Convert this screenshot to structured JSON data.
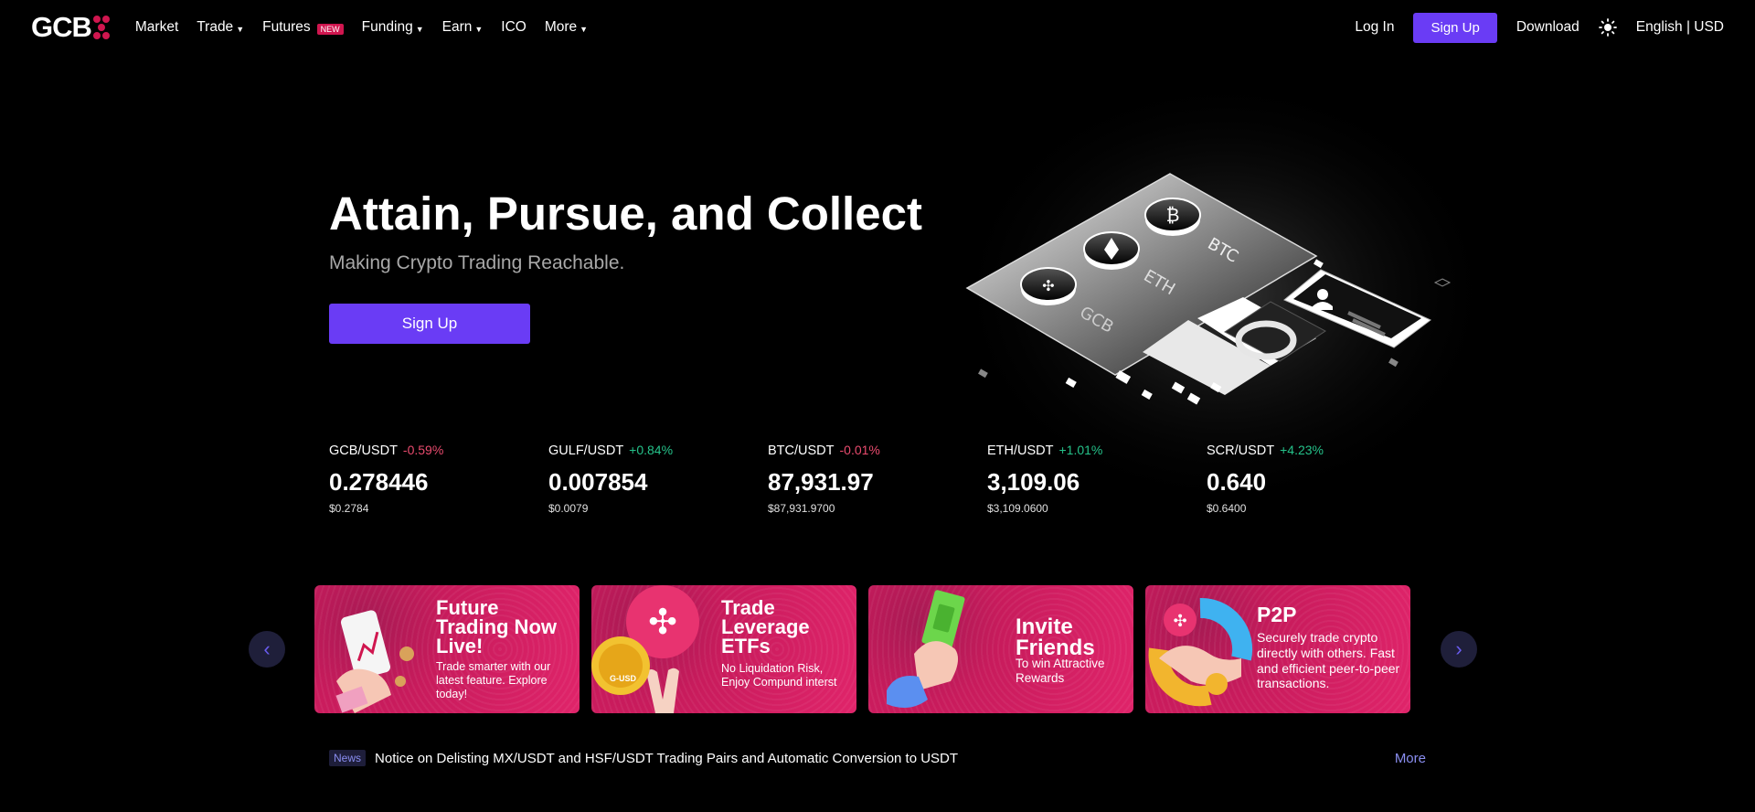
{
  "nav": {
    "logo": "GCB",
    "items": [
      {
        "label": "Market",
        "caret": false
      },
      {
        "label": "Trade",
        "caret": true
      },
      {
        "label": "Futures",
        "caret": false,
        "badge": "NEW"
      },
      {
        "label": "Funding",
        "caret": true
      },
      {
        "label": "Earn",
        "caret": true
      },
      {
        "label": "ICO",
        "caret": false
      },
      {
        "label": "More",
        "caret": true
      }
    ],
    "login": "Log In",
    "signup": "Sign Up",
    "download": "Download",
    "locale": "English | USD"
  },
  "hero": {
    "title": "Attain, Pursue, and Collect",
    "subtitle": "Making Crypto Trading Reachable.",
    "cta": "Sign Up",
    "art_labels": [
      "BTC",
      "ETH",
      "GCB"
    ]
  },
  "tickers": [
    {
      "pair": "GCB/USDT",
      "change": "-0.59%",
      "dir": "neg",
      "price": "0.278446",
      "usd": "$0.2784"
    },
    {
      "pair": "GULF/USDT",
      "change": "+0.84%",
      "dir": "pos",
      "price": "0.007854",
      "usd": "$0.0079"
    },
    {
      "pair": "BTC/USDT",
      "change": "-0.01%",
      "dir": "neg",
      "price": "87,931.97",
      "usd": "$87,931.9700"
    },
    {
      "pair": "ETH/USDT",
      "change": "+1.01%",
      "dir": "pos",
      "price": "3,109.06",
      "usd": "$3,109.0600"
    },
    {
      "pair": "SCR/USDT",
      "change": "+4.23%",
      "dir": "pos",
      "price": "0.640",
      "usd": "$0.6400"
    }
  ],
  "banners": [
    {
      "title": "Future Trading Now Live!",
      "desc": "Trade smarter with our latest feature. Explore today!"
    },
    {
      "title": "Trade Leverage ETFs",
      "desc": "No Liquidation Risk, Enjoy Compund interst",
      "coin": "G-USD"
    },
    {
      "title": "Invite Friends",
      "desc": "To win Attractive Rewards"
    },
    {
      "title": "P2P",
      "desc": "Securely trade crypto directly with others. Fast and efficient peer-to-peer transactions."
    }
  ],
  "news": {
    "tag": "News",
    "text": "Notice on Delisting MX/USDT and HSF/USDT Trading Pairs and Automatic Conversion to USDT",
    "more": "More"
  },
  "colors": {
    "accent": "#6a3cf5",
    "brand_red": "#d0164f",
    "negative": "#e94b6e",
    "positive": "#25c28a",
    "banner_pink": "#e0246a"
  },
  "icons": {
    "theme_toggle": "sun-icon",
    "carousel_prev": "chevron-left-icon",
    "carousel_next": "chevron-right-icon"
  }
}
